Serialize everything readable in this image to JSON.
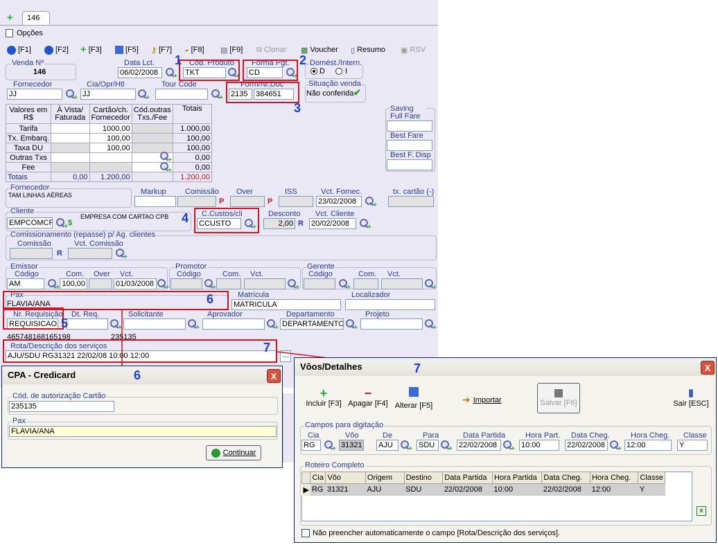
{
  "main": {
    "tab": "146",
    "options_label": "Opções",
    "toolbar": {
      "f1": "[F1]",
      "f2": "[F2]",
      "f3": "[F3]",
      "f5": "[F5]",
      "f7": "[F7]",
      "f8": "[F8]",
      "f9": "[F9]",
      "clonar": "Clonar",
      "voucher": "Voucher",
      "resumo": "Resumo",
      "rsv": "RSV"
    },
    "venda": {
      "label": "Venda Nº",
      "value": "146"
    },
    "data_lct": {
      "label": "Data Lct.",
      "value": "06/02/2008"
    },
    "cod_produto": {
      "label": "Cod. Produto",
      "value": "TKT"
    },
    "forma_pgt": {
      "label": "Forma Pgt.",
      "value": "CD"
    },
    "domest": {
      "label": "Domést./Intern.",
      "opt_d": "D",
      "opt_i": "I"
    },
    "fornecedor": {
      "label": "Fornecedor",
      "value": "JJ"
    },
    "cia": {
      "label": "Cia/Opr/Htl",
      "value": "JJ"
    },
    "tour_code": {
      "label": "Tour Code",
      "value": ""
    },
    "form_doc": {
      "label": "Form/Nr.Doc",
      "form": "2135",
      "doc": "384651"
    },
    "situacao": {
      "label": "Situação venda",
      "value": "Não conferida"
    },
    "valores": {
      "headers": [
        "Valores em R$",
        "À Vista/ Faturada",
        "Cartão/ch. Fornecedor",
        "Cód.outras Txs./Fee",
        "Totais"
      ],
      "rows": [
        [
          "Tarifa",
          "",
          "1000,00",
          "",
          "1.000,00"
        ],
        [
          "Tx. Embarq.",
          "",
          "100,00",
          "",
          "100,00"
        ],
        [
          "Taxa DU",
          "",
          "100,00",
          "",
          "100,00"
        ],
        [
          "Outras Txs",
          "",
          "",
          "",
          "0,00"
        ],
        [
          "Fee",
          "",
          "",
          "",
          "0,00"
        ],
        [
          "Totais",
          "0,00",
          "1.200,00",
          "",
          "1.200,00"
        ]
      ]
    },
    "saving": {
      "full_fare": "Saving Full Fare",
      "best_fare": "Best Fare",
      "best_disp": "Best F. Disp"
    },
    "fornecedor2": {
      "label": "Fornecedor",
      "value": "TAM LINHAS AÉREAS"
    },
    "markup": "Markup",
    "comissao": "Comissão",
    "over": "Over",
    "iss": "ISS",
    "vct_fornec": {
      "label": "Vct. Fornec.",
      "value": "23/02/2008"
    },
    "tx_cartao": "tx. cartão (-)",
    "p_mark": "P",
    "cliente": {
      "label": "Cliente",
      "value": "EMPCOMCP",
      "name": "EMPRESA COM CARTAO CPB",
      "dollar": "$"
    },
    "ccustos": {
      "label": "C.Custos/cli",
      "value": "CCUSTO"
    },
    "desconto": {
      "label": "Desconto",
      "value": "2,00",
      "r": "R"
    },
    "vct_cliente": {
      "label": "Vct. Cliente",
      "value": "20/02/2008"
    },
    "comissionamento": {
      "label": "Comissionamento (repasse) p/ Ag. clientes",
      "comissao": "Comissão",
      "vct": "Vct. Comissão",
      "r": "R"
    },
    "emissor": {
      "label": "Emissor",
      "codigo_label": "Código",
      "codigo": "AM",
      "com_label": "Com.",
      "com": "100,00",
      "over_label": "Over",
      "vct_label": "Vct.",
      "vct": "01/03/2008"
    },
    "promotor": {
      "label": "Promotor",
      "codigo": "Código",
      "com": "Com.",
      "vct": "Vct."
    },
    "gerente": {
      "label": "Gerente",
      "codigo": "Código",
      "com": "Com.",
      "vct": "Vct."
    },
    "pax": {
      "label": "Pax",
      "value": "FLAVIA/ANA"
    },
    "matricula": {
      "label": "Matrícula",
      "value": "MATRICULA"
    },
    "localizador": {
      "label": "Localizador",
      "value": ""
    },
    "nr_requisicao": {
      "label": "Nr. Requisição",
      "value": "REQUISICAO"
    },
    "dt_req": "Dt. Req.",
    "solicitante": "Solicitante",
    "aprovador": "Aprovador",
    "departamento": {
      "label": "Departamento",
      "value": "DEPARTAMENTO"
    },
    "projeto": "Projeto",
    "codes": {
      "a": "465748168165198",
      "b": "235135"
    },
    "rota": {
      "label": "Rota/Descrição dos serviços",
      "value": "AJU/SDU RG31321 22/02/08 10:00 12:00"
    }
  },
  "callouts": {
    "n1": "1",
    "n2": "2",
    "n3": "3",
    "n4": "4",
    "n5": "5",
    "n6": "6",
    "n7": "7"
  },
  "cpa": {
    "title": "CPA - Credicard",
    "close": "X",
    "cod_label": "Cód. de autorização Cartão",
    "cod_value": "235135",
    "pax_label": "Pax",
    "pax_value": "FLAVIA/ANA",
    "continuar": "Continuar"
  },
  "voos": {
    "title": "Vôos/Detalhes",
    "close": "X",
    "toolbar": {
      "incluir": "Incluir [F3]",
      "apagar": "Apagar [F4]",
      "alterar": "Alterar [F5]",
      "importar": "Importar",
      "salvar": "Salvar [F6]",
      "sair": "Sair [ESC]"
    },
    "campos_label": "Campos para digitação",
    "fields": {
      "cia": {
        "label": "Cia",
        "value": "RG"
      },
      "voo": {
        "label": "Vôo",
        "value": "31321"
      },
      "de": {
        "label": "De",
        "value": "AJU"
      },
      "para": {
        "label": "Para",
        "value": "SDU"
      },
      "data_partida": {
        "label": "Data Partida",
        "value": "22/02/2008"
      },
      "hora_part": {
        "label": "Hora Part.",
        "value": "10:00"
      },
      "data_cheg": {
        "label": "Data Cheg.",
        "value": "22/02/2008"
      },
      "hora_cheg": {
        "label": "Hora Cheg.",
        "value": "12:00"
      },
      "classe": {
        "label": "Classe",
        "value": "Y"
      }
    },
    "roteiro_label": "Roteiro Completo",
    "columns": [
      "Cia",
      "Vôo",
      "Origem",
      "Destino",
      "Data Partida",
      "Hora Partida",
      "Data Cheg.",
      "Hora Cheg.",
      "Classe"
    ],
    "rows": [
      [
        "RG",
        "31321",
        "AJU",
        "SDU",
        "22/02/2008",
        "10:00",
        "22/02/2008",
        "12:00",
        "Y"
      ]
    ],
    "checkbox_label": "Não preencher automaticamente o campo [Rota/Descrição dos serviços]."
  }
}
